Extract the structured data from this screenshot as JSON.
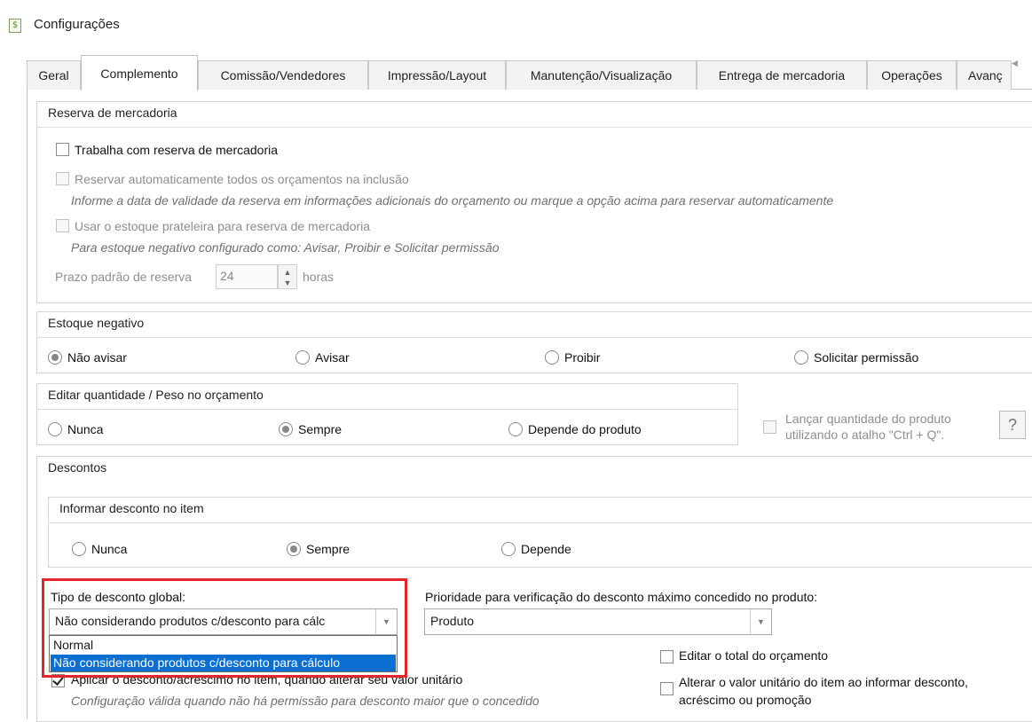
{
  "window": {
    "title": "Configurações",
    "icon": "dollar-doc-icon"
  },
  "tabs": [
    "Geral",
    "Complemento",
    "Comissão/Vendedores",
    "Impressão/Layout",
    "Manutenção/Visualização",
    "Entrega de mercadoria",
    "Operações",
    "Avanç"
  ],
  "active_tab": "Complemento",
  "reserva": {
    "title": "Reserva de mercadoria",
    "trabalha": "Trabalha com reserva de mercadoria",
    "reservar_auto": "Reservar automaticamente todos os orçamentos na inclusão",
    "note1": "Informe a data de validade da reserva em informações adicionais do orçamento ou marque a opção acima para reservar automaticamente",
    "usar_estoque": "Usar o estoque prateleira para reserva de mercadoria",
    "note2": "Para estoque negativo configurado como: Avisar, Proibir e Solicitar permissão",
    "prazo_label": "Prazo padrão de reserva",
    "prazo_value": "24",
    "prazo_unit": "horas"
  },
  "estoque": {
    "title": "Estoque negativo",
    "options": [
      "Não avisar",
      "Avisar",
      "Proibir",
      "Solicitar permissão"
    ],
    "selected": "Não avisar"
  },
  "editar_qtd": {
    "title": "Editar quantidade / Peso no orçamento",
    "options": [
      "Nunca",
      "Sempre",
      "Depende do produto"
    ],
    "selected": "Sempre",
    "lancar_line1": "Lançar quantidade do produto",
    "lancar_line2": "utilizando o atalho \"Ctrl + Q\".",
    "help": "?"
  },
  "descontos": {
    "title": "Descontos",
    "informar_title": "Informar desconto no item",
    "informar_options": [
      "Nunca",
      "Sempre",
      "Depende"
    ],
    "informar_selected": "Sempre",
    "tipo_label": "Tipo de desconto global:",
    "tipo_value": "Não considerando produtos c/desconto para cálc",
    "tipo_options": [
      "Normal",
      "Não considerando produtos c/desconto para cálculo"
    ],
    "tipo_selected_option": "Não considerando produtos c/desconto para cálculo",
    "prioridade_label": "Prioridade para verificação do desconto máximo concedido no produto:",
    "prioridade_value": "Produto",
    "editar_total": "Editar o total do orçamento",
    "alterar_line1": "Alterar o valor unitário do item ao informar desconto,",
    "alterar_line2": "acréscimo ou promoção",
    "aplicar": "Aplicar o desconto/acréscimo no item, quando alterar seu valor unitário",
    "aplicar_note": "Configuração válida quando não há permissão para desconto maior que o concedido"
  }
}
